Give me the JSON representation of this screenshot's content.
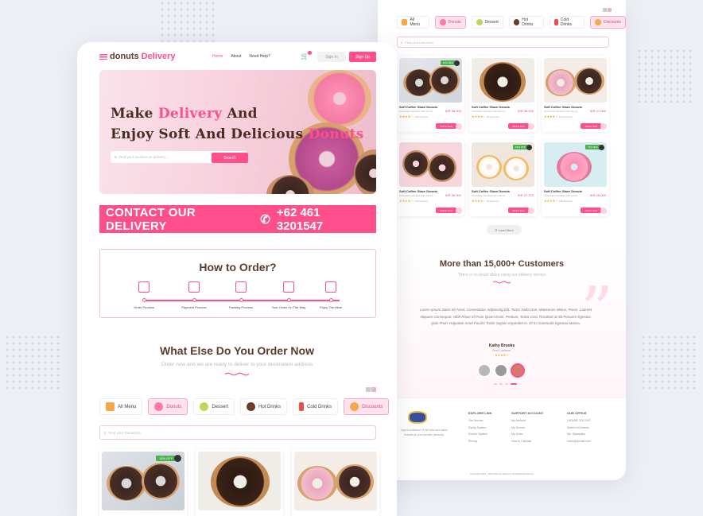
{
  "colors": {
    "accent": "#ff4e8c",
    "brown": "#5a3b2e",
    "tab_active_bg": "#ffe3ee"
  },
  "nav": {
    "logo_a": "donuts",
    "logo_b": "Delivery",
    "links": [
      "Home",
      "About",
      "Need Help?"
    ],
    "signin": "Sign In",
    "signup": "Sign Up"
  },
  "hero": {
    "line1_a": "Make ",
    "line1_b": "Delivery",
    "line1_c": " And",
    "line2_a": "Enjoy Soft And Delicious ",
    "line2_b": "Donuts",
    "search_placeholder": "Find your location on delivery...",
    "search_button": "Search"
  },
  "contact": {
    "label": "CONTACT OUR DELIVERY",
    "phone": "+62 461 3201547"
  },
  "howto": {
    "title": "How to Order?",
    "steps": [
      "Order Process",
      "Payment Process",
      "Packing Process",
      "Your Order On The Way",
      "Enjoy The Meal"
    ]
  },
  "order_now": {
    "title": "What Else Do You Order Now",
    "subtitle": "Order now and we are ready to deliver to your destination address"
  },
  "tabs": [
    "All Menu",
    "Donuts",
    "Dessert",
    "Hot Drinks",
    "Cold Drinks",
    "Discounts"
  ],
  "menu_search_placeholder": "Find your Donutlove",
  "products": [
    {
      "name": "Soft Coffee Glaze Donuts",
      "price": "IDR 36.000",
      "sub": "Chocolate sprinkles with donuts",
      "reviews": "156 Reviews",
      "badge": "15% OFF",
      "cart": "Add to Cart"
    },
    {
      "name": "Soft Coffee Glaze Donuts",
      "price": "IDR 36.000",
      "sub": "Chocolate sprinkles with donuts",
      "reviews": "94 Reviews",
      "badge": "",
      "cart": "Add to Cart"
    },
    {
      "name": "Soft Coffee Glaze Donuts",
      "price": "IDR 17.000",
      "sub": "Chocolate sprinkles with donuts",
      "reviews": "112 Reviews",
      "badge": "",
      "cart": "Add to Cart"
    },
    {
      "name": "Soft Coffee Glaze Donuts",
      "price": "IDR 36.000",
      "sub": "Chocolate sprinkles with donuts",
      "reviews": "156 Reviews",
      "badge": "",
      "cart": "Add to Cart"
    },
    {
      "name": "Soft Coffee Glaze Donuts",
      "price": "IDR 27.373",
      "sub": "Chocolate sprinkles with donuts",
      "reviews": "56 Reviews",
      "badge": "25% OFF",
      "cart": "Add to Cart"
    },
    {
      "name": "Soft Coffee Glaze Donuts",
      "price": "IDR 16.000",
      "sub": "Chocolate sprinkles with donuts",
      "reviews": "156 Reviews",
      "badge": "15% OFF",
      "cart": "Add to Cart"
    }
  ],
  "load_more": "Load More",
  "testimonial": {
    "title": "More than 15,000+ Customers",
    "subtitle": "There is no doubt about using our delivery service",
    "body": "Lorem Ipsum Dolor Sit Amet, Consectetur Adipiscing Elit. Tortor Nulla Non, Maecenas Metus, Purus. Laoreet Aliquam Consequat. Nibh Risus Id Proin Quam Enim. Pretium, Tortor Cras Tincidunt at Sit Posuere Egestas. Quis Proin Vulputate Amet Facilisi Tortor Sapien Imperdiet In. Et In Commodo Egestas Massa.",
    "author": "Kathy Brooke",
    "role": "Best Customer"
  },
  "footer": {
    "desc": "Jaya's collection of the best and latest threads at your favorite (cinema)",
    "explore_title": "EXPLORE LINK",
    "explore": [
      "Our Service",
      "Equity System",
      "Refund System",
      "Pricing"
    ],
    "support_title": "SUPPORT ACCOUNT",
    "support": [
      "My Account",
      "My Donuts",
      "My Order",
      "How to Tutorials"
    ],
    "office_title": "OUR OFFICE",
    "office": [
      "(+62)462 320 1547",
      "District of Debean",
      "Ms. Streetylino",
      "order@donuts.com"
    ],
    "copyright": "Copyright 2021 - 2022 Donuts Delivery. All Rights Reserved."
  }
}
